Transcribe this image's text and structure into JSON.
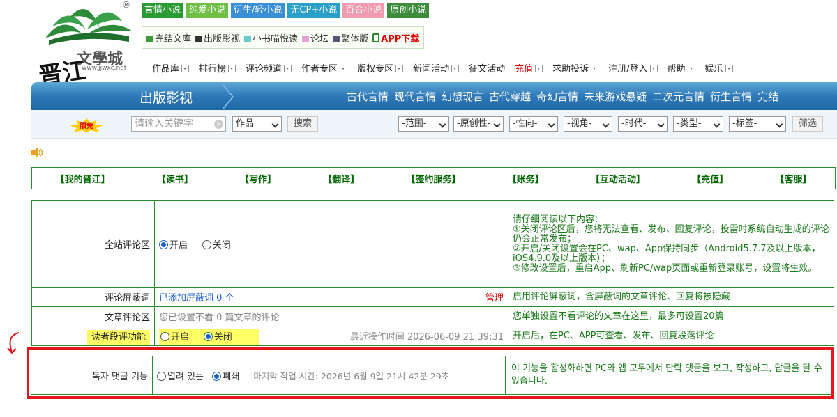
{
  "logo": {
    "text": "文學城",
    "url_text": "www.jjwxc.net",
    "mark": "晋江",
    "registered": "®"
  },
  "top_tags": [
    {
      "label": "言情小说",
      "color": "#2a9a35"
    },
    {
      "label": "纯爱小说",
      "color": "#6fbe45"
    },
    {
      "label": "衍生/轻小说",
      "color": "#3a8fd6"
    },
    {
      "label": "无CP+小说",
      "color": "#2aa0c8"
    },
    {
      "label": "百合小说",
      "color": "#f09cb0"
    },
    {
      "label": "原创小说",
      "color": "#3c8c3c"
    }
  ],
  "sublinks": [
    {
      "label": "完结文库",
      "icon": "check-icon"
    },
    {
      "label": "出版影视",
      "icon": "film-icon"
    },
    {
      "label": "小书喵悦读",
      "icon": "cat-icon"
    },
    {
      "label": "论坛",
      "icon": "chat-icon"
    },
    {
      "label": "繁体版",
      "icon": "book-icon"
    },
    {
      "label": "APP下载",
      "icon": "phone-icon"
    }
  ],
  "main_nav": [
    {
      "label": "作品库",
      "dropdown": true
    },
    {
      "label": "排行榜",
      "dropdown": true
    },
    {
      "label": "评论频道",
      "dropdown": true
    },
    {
      "label": "作者专区",
      "dropdown": true
    },
    {
      "label": "版权专区",
      "dropdown": true
    },
    {
      "label": "新闻活动",
      "dropdown": true
    },
    {
      "label": "征文活动",
      "dropdown": false
    },
    {
      "label": "充值",
      "dropdown": true,
      "highlight": true
    },
    {
      "label": "求助投诉",
      "dropdown": true
    },
    {
      "label": "注册/登入",
      "dropdown": true
    },
    {
      "label": "帮助",
      "dropdown": true
    },
    {
      "label": "娱乐",
      "dropdown": true
    }
  ],
  "banner": {
    "title": "出版影视",
    "categories": [
      "古代言情",
      "现代言情",
      "幻想现言",
      "古代穿越",
      "奇幻言情",
      "未来游戏悬疑",
      "二次元言情",
      "衍生言情",
      "完结"
    ]
  },
  "filter": {
    "badge": "限免",
    "search_placeholder": "请输入关键字",
    "type_select": "作品",
    "search_button": "搜索",
    "selects": [
      "-范围-",
      "-原创性-",
      "-性向-",
      "-视角-",
      "-时代-",
      "-类型-",
      "-标签-"
    ],
    "filter_button": "筛选"
  },
  "green_menu": [
    "【我的晋江】",
    "【读书】",
    "【写作】",
    "【翻译】",
    "【签约服务】",
    "【账务】",
    "【互动活动】",
    "【充值】",
    "【客服】"
  ],
  "settings": {
    "site_comments": {
      "label": "全站评论区",
      "on": "开启",
      "off": "关闭",
      "note": "请仔细阅读以下内容：\n①关闭评论区后，您将无法查看、发布、回复评论，投雷时系统自动生成的评论仍会正常发布；\n②开启/关闭设置会在PC、wap、App保持同步（Android5.7.7及以上版本，iOS4.9.0及以上版本）；\n③修改设置后，重启App、刷新PC/wap页面或重新登录账号，设置将生效。"
    },
    "block_words": {
      "label": "评论屏蔽词",
      "value": "已添加屏蔽词 0 个",
      "manage": "管理",
      "note": "启用评论屏蔽词，含屏蔽词的文章评论、回复将被隐藏"
    },
    "article_comments": {
      "label": "文章评论区",
      "value": "您已设置不看 0 篇文章的评论",
      "note": "您单独设置不看评论的文章在这里，最多可设置20篇"
    },
    "paragraph_comments": {
      "label": "读者段评功能",
      "on": "开启",
      "off": "关闭",
      "last_op": "最近操作时间 2026-06-09 21:39:31",
      "note": "开启后，在PC、APP可查看、发布、回复段落评论"
    }
  },
  "korean_overlay": {
    "label": "독자 댓글 기능",
    "on": "열려 있는",
    "off": "폐쇄",
    "last_op": "마지막 작업 시간: 2026년 6월 9일 21시 42분 29초",
    "note": "이 기능을 활성화하면 PC와 앱 모두에서 단락 댓글을 보고, 작성하고, 답글을 달 수 있습니다."
  }
}
